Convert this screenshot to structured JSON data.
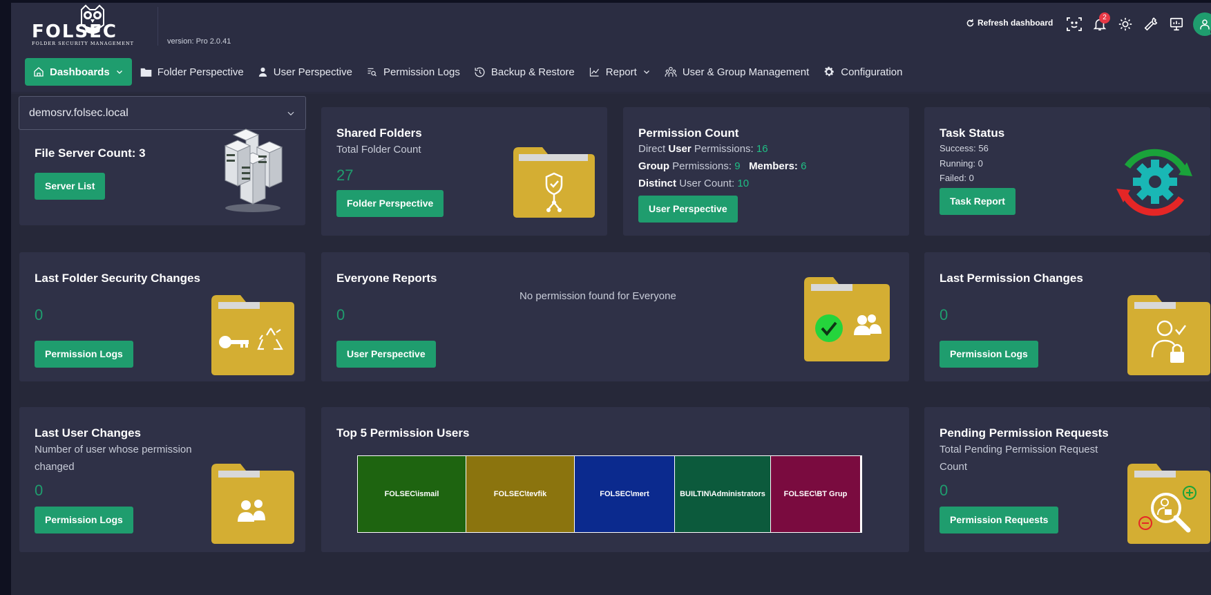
{
  "header": {
    "logo_text": "FOLSEC",
    "logo_subtitle": "FOLDER SECURITY MANAGEMENT",
    "version": "version: Pro 2.0.41",
    "refresh_label": "Refresh dashboard",
    "notification_count": "2"
  },
  "nav": {
    "dashboards": "Dashboards",
    "folder_perspective": "Folder Perspective",
    "user_perspective": "User Perspective",
    "permission_logs": "Permission Logs",
    "backup_restore": "Backup & Restore",
    "report": "Report",
    "user_group_mgmt": "User & Group Management",
    "configuration": "Configuration"
  },
  "server": {
    "selected": "demosrv.folsec.local",
    "count_label": "File Server Count: 3",
    "button": "Server List"
  },
  "shared_folders": {
    "title": "Shared Folders",
    "subtitle": "Total Folder Count",
    "count": "27",
    "button": "Folder Perspective"
  },
  "permission_count": {
    "title": "Permission Count",
    "direct_prefix": "Direct",
    "direct_bold": "User",
    "direct_suffix": "Permissions:",
    "direct_value": "16",
    "group_bold": "Group",
    "group_suffix": "Permissions:",
    "group_value": "9",
    "members_label": "Members:",
    "members_value": "6",
    "distinct_bold": "Distinct",
    "distinct_suffix": "User Count:",
    "distinct_value": "10",
    "button": "User Perspective"
  },
  "task_status": {
    "title": "Task Status",
    "success": "Success: 56",
    "running": "Running: 0",
    "failed": "Failed: 0",
    "button": "Task Report"
  },
  "last_folder_changes": {
    "title": "Last Folder Security Changes",
    "count": "0",
    "button": "Permission Logs"
  },
  "everyone_reports": {
    "title": "Everyone Reports",
    "message": "No permission found for Everyone",
    "count": "0",
    "button": "User Perspective"
  },
  "last_permission_changes": {
    "title": "Last Permission Changes",
    "count": "0",
    "button": "Permission Logs"
  },
  "last_user_changes": {
    "title": "Last User Changes",
    "subtitle_1": "Number of user whose permission",
    "subtitle_2": "changed",
    "count": "0",
    "button": "Permission Logs"
  },
  "top_users": {
    "title": "Top 5 Permission Users",
    "items": [
      {
        "label": "FOLSEC\\ismail",
        "color": "#1e6410"
      },
      {
        "label": "FOLSEC\\tevfik",
        "color": "#8b740e"
      },
      {
        "label": "FOLSEC\\mert",
        "color": "#0b2a8e"
      },
      {
        "label": "BUILTIN\\Administrators",
        "color": "#0c5a3c"
      },
      {
        "label": "FOLSEC\\BT Grup",
        "color": "#7a0b3f"
      }
    ]
  },
  "pending_requests": {
    "title": "Pending Permission Requests",
    "subtitle_1": "Total Pending Permission Request",
    "subtitle_2": "Count",
    "count": "0",
    "button": "Permission Requests"
  },
  "colors": {
    "accent": "#1f9d6e",
    "folder": "#d4ae33",
    "card": "#2f3147",
    "background": "#262839"
  }
}
